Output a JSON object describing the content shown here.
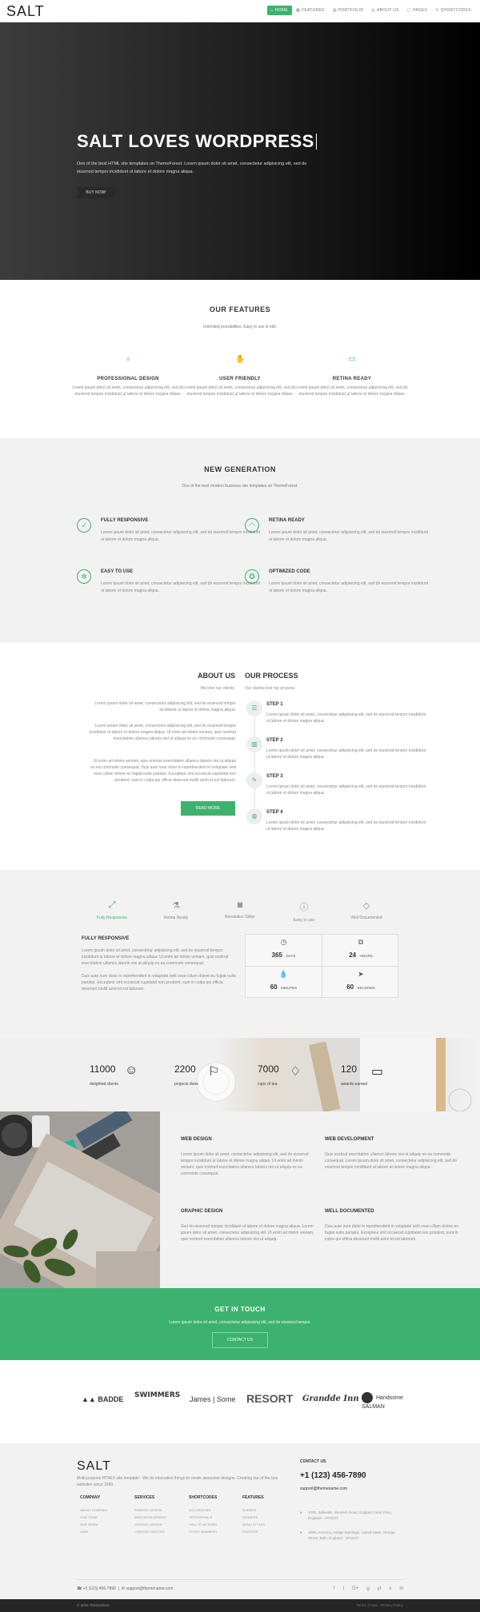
{
  "nav": {
    "logo": "SALT",
    "items": [
      {
        "label": "HOME",
        "icon": "home-icon"
      },
      {
        "label": "FEATURES",
        "icon": "features-icon"
      },
      {
        "label": "PORTFOLIO",
        "icon": "portfolio-icon"
      },
      {
        "label": "ABOUT US",
        "icon": "about-icon"
      },
      {
        "label": "PAGES",
        "icon": "pages-icon"
      },
      {
        "label": "SHORTCODES",
        "icon": "shortcodes-icon"
      }
    ]
  },
  "hero": {
    "title": "SALT LOVES WORDPRESS",
    "text": "One of the best HTML site templates on ThemeForest. Lorem ipsum dolor sit amet, consectetur adipisicing elit, sed do eiusmod tempor incididunt ut labore et dolore magna aliqua.",
    "button": "BUY NOW!"
  },
  "features": {
    "title": "OUR FEATURES",
    "subtitle": "Unlimited possibilities. Easy to use & edit.",
    "items": [
      {
        "title": "PROFESSIONAL DESIGN",
        "text": "Lorem ipsum dolor sit amet, consectetur adipisicing elit, sed do eiusmod tempor incididunt ut labore et dolore magna aliqua."
      },
      {
        "title": "USER FRIENDLY",
        "text": "Lorem ipsum dolor sit amet, consectetur adipisicing elit, sed do eiusmod tempor incididunt ut labore et dolore magna aliqua."
      },
      {
        "title": "RETINA READY",
        "text": "Lorem ipsum dolor sit amet, consectetur adipisicing elit, sed do eiusmod tempor incididunt ut labore et dolore magna aliqua."
      }
    ]
  },
  "generation": {
    "title": "NEW GENERATION",
    "subtitle": "One of the best modern business site templates on ThemeForest.",
    "items": [
      {
        "title": "FULLY RESPONSIVE",
        "text": "Lorem ipsum dolor sit amet, consectetur adipisicing elit, sed do eiusmod tempor incididunt ut labore et dolore magna aliqua."
      },
      {
        "title": "RETINA READY",
        "text": "Lorem ipsum dolor sit amet, consectetur adipisicing elit, sed do eiusmod tempor incididunt ut labore et dolore magna aliqua."
      },
      {
        "title": "EASY TO USE",
        "text": "Lorem ipsum dolor sit amet, consectetur adipisicing elit, sed do eiusmod tempor incididunt ut labore et dolore magna aliqua."
      },
      {
        "title": "OPTIMIZED CODE",
        "text": "Lorem ipsum dolor sit amet, consectetur adipisicing elit, sed do eiusmod tempor incididunt ut labore et dolore magna aliqua."
      }
    ]
  },
  "about": {
    "title": "ABOUT US",
    "subtitle": "We love our clients.",
    "p1": "Lorem ipsum dolor sit amet, consectetur adipisicing elit, sed do eiusmod tempor incididunt ut labore et dolore magna aliqua.",
    "p2": "Lorem ipsum dolor sit amet, consectetur adipisicing elit, sed do eiusmod tempor incididunt ut labore et dolore magna aliqua. Ut enim ad minim veniam, quis nostrud exercitation ullamco laboris nisi ut aliquip ex ea commodo consequat.",
    "p3": "Ut enim ad minim veniam, quis nostrud exercitation ullamco laboris nisi ut aliquip ex ea commodo consequat. Duis aute irure dolor in reprehenderit in voluptate velit esse cillum dolore eu fugiat nulla pariatur. Excepteur sint occaecat cupidatat non proident, sunt in culpa qui officia deserunt mollit anim id est laborum.",
    "button": "READ MORE"
  },
  "process": {
    "title": "OUR PROCESS",
    "subtitle": "Our clients love our process.",
    "steps": [
      {
        "title": "STEP 1",
        "text": "Lorem ipsum dolor sit amet, consectetur adipisicing elit, sed do eiusmod tempor incididunt ut labore et dolore magna aliqua."
      },
      {
        "title": "STEP 2",
        "text": "Lorem ipsum dolor sit amet, consectetur adipisicing elit, sed do eiusmod tempor incididunt ut labore et dolore magna aliqua."
      },
      {
        "title": "STEP 3",
        "text": "Lorem ipsum dolor sit amet, consectetur adipisicing elit, sed do eiusmod tempor incididunt ut labore et dolore magna aliqua."
      },
      {
        "title": "STEP 4",
        "text": "Lorem ipsum dolor sit amet, consectetur adipisicing elit, sed do eiusmod tempor incididunt ut labore et dolore magna aliqua."
      }
    ]
  },
  "tabs": {
    "items": [
      "Fully Responsive",
      "Retina Ready",
      "Revolution Slider",
      "Easy to use",
      "Well Documented"
    ],
    "active_title": "FULLY RESPONSIVE",
    "p1": "Lorem ipsum dolor sit amet, consectetur adipisicing elit, sed do eiusmod tempor incididunt ut labore et dolore magna aliqua. Ut enim ad minim veniam, quis nostrud exercitation ullamco laboris nisi ut aliquip ex ea commodo consequat.",
    "p2": "Duis aute irure dolor in reprehenderit in voluptate velit esse cillum dolore eu fugiat nulla pariatur. Excepteur sint occaecat cupidatat non proident, sunt in culpa qui officia deserunt mollit anim id est laborum."
  },
  "timer": {
    "days": "365",
    "days_label": "DAYS",
    "hours": "24",
    "hours_label": "HOURS",
    "minutes": "60",
    "minutes_label": "MINUTES",
    "seconds": "60",
    "seconds_label": "SECONDS"
  },
  "counters": [
    {
      "num": "11000",
      "label": "delighted clients"
    },
    {
      "num": "2200",
      "label": "projects done"
    },
    {
      "num": "7000",
      "label": "cups of tea"
    },
    {
      "num": "120",
      "label": "awards earned"
    }
  ],
  "services": [
    {
      "title": "WEB DESIGN",
      "text": "Lorem ipsum dolor sit amet, consectetur adipisicing elit, sed do eiusmod tempor incididunt ut labore et dolore magna aliqua. Ut enim ad minim veniam, quis nostrud exercitation ullamco laboris nisi ut aliquip ex ea commodo consequat."
    },
    {
      "title": "WEB DEVELOPMENT",
      "text": "Quis nostrud exercitation ullamco laboris nisi ut aliquip ex ea commodo consequat. Lorem ipsum dolor sit amet, consectetur adipisicing elit, sed do eiusmod tempor incididunt ut labore et dolore magna aliqua."
    },
    {
      "title": "GRAPHIC DESIGN",
      "text": "Sed do eiusmod tempor incididunt ut labore et dolore magna aliqua. Lorem ipsum dolor sit amet, consectetur adipisicing elit. Ut enim ad minim veniam, quis nostrud exercitation ullamco laboris nisi ut aliquip."
    },
    {
      "title": "WELL DOCUMENTED",
      "text": "Duis aute irure dolor in reprehenderit in voluptate velit esse cillum dolore eu fugiat nulla pariatur. Excepteur sint occaecat cupidatat non proident, sunt in culpa qui officia deserunt mollit anim id est laborum."
    }
  ],
  "cta": {
    "title": "GET IN TOUCH",
    "text": "Lorem ipsum dolor sit amet, consectetur adipisicing elit, sed do eiusmod tempor.",
    "button": "CONTACT US"
  },
  "logos": [
    "BADDE",
    "SWIMMERS",
    "James | Some",
    "RESORT",
    "Grandde Inn",
    "Handsome SALMAN"
  ],
  "footer": {
    "logo": "SALT",
    "desc": "Multi-purpose HTML5 site template - We do innovative things to create awesome designs. Creating our of the box websites since 1999.",
    "columns": [
      {
        "title": "COMPANY",
        "links": [
          "ABOUT COMPANY",
          "OUR TEAM",
          "OUR WORK",
          "JOBS"
        ]
      },
      {
        "title": "SERVICES",
        "links": [
          "WEBSITE DESIGN",
          "WEB DEVELOPMENT",
          "GRAPHIC DESIGN",
          "CONTENT WRITING"
        ]
      },
      {
        "title": "SHORTCODES",
        "links": [
          "ACCORDIONS",
          "TESTIMONIALS",
          "CALL TO ACTIONS",
          "STICKY NUMBERS"
        ]
      },
      {
        "title": "FEATURES",
        "links": [
          "SLIDERS",
          "HEADERS",
          "MENU STYLES",
          "FOOTERS"
        ]
      }
    ],
    "contact_title": "CONTACT US",
    "phone": "+1 (123) 456-7890",
    "email": "support@themename.com",
    "address1": "1000, Sidewalk, Western Road, England, Next Floor, England - 1P4SOT",
    "address2": "1000, America, Hedge Buildings, United State, George Street, Bath, England - 1P4SOT",
    "bar_phone": "+1 (123) 456-7890",
    "bar_email": "support@themename.com",
    "socials": [
      "f",
      "t",
      "G+",
      "g",
      "yt",
      "v",
      "in"
    ],
    "copyright": "© 2016 ThemeStore.",
    "bottom_links": "Terms of Use  -  Privacy Policy"
  }
}
